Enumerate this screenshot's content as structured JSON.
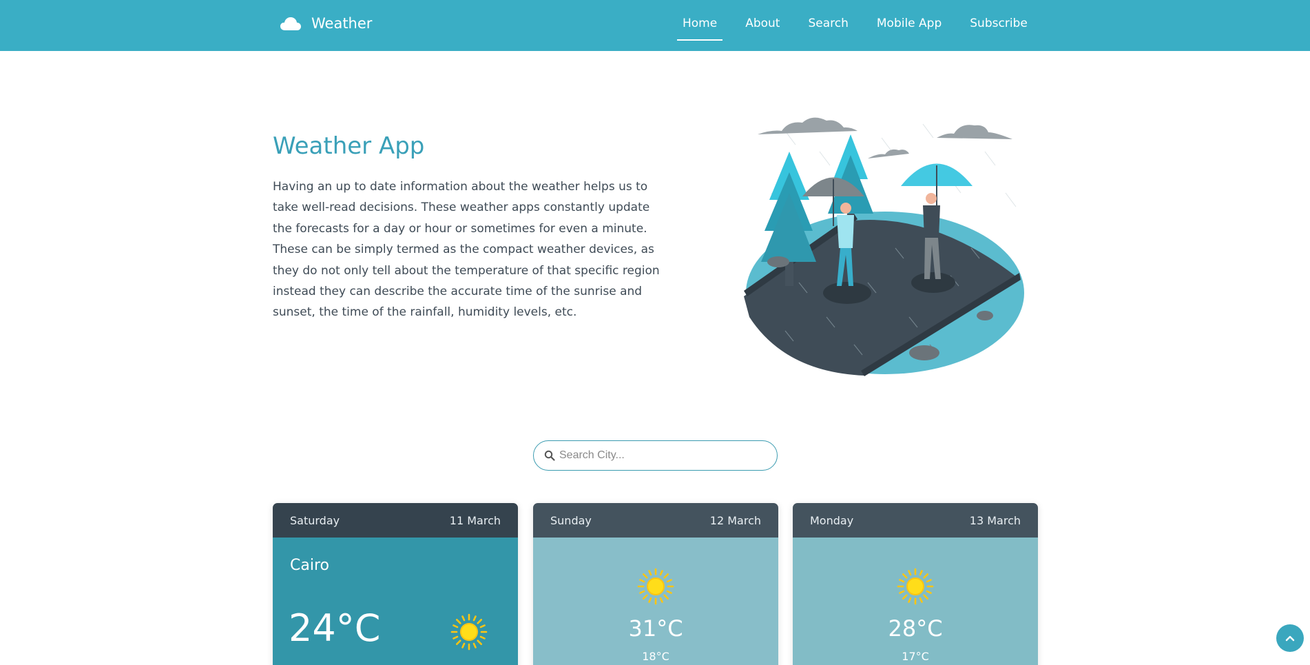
{
  "nav": {
    "brand": "Weather",
    "brand_icon": "cloud-icon",
    "links": [
      {
        "label": "Home",
        "active": true
      },
      {
        "label": "About"
      },
      {
        "label": "Search"
      },
      {
        "label": "Mobile App"
      },
      {
        "label": "Subscribe"
      }
    ]
  },
  "hero": {
    "title": "Weather App",
    "description": "Having an up to date information about the weather helps us to take well-read decisions. These weather apps constantly update the forecasts for a day or hour or sometimes for even a minute. These can be simply termed as the compact weather devices, as they do not only tell about the temperature of that specific region instead they can describe the accurate time of the sunrise and sunset, the time of the rainfall, humidity levels, etc."
  },
  "search": {
    "placeholder": "Search City...",
    "value": "",
    "icon": "search-icon"
  },
  "forecast": [
    {
      "day": "Saturday",
      "date": "11 March",
      "city": "Cairo",
      "temp": "24°C",
      "icon": "sun-icon"
    },
    {
      "day": "Sunday",
      "date": "12 March",
      "max": "31°C",
      "min": "18°C",
      "icon": "sun-icon"
    },
    {
      "day": "Monday",
      "date": "13 March",
      "max": "28°C",
      "min": "17°C",
      "icon": "sun-icon"
    }
  ],
  "scroll_top": {
    "icon": "chevron-up-icon"
  },
  "colors": {
    "navbar": "#3aaec5",
    "accent": "#3aa0b8",
    "card_today_head": "#35434e",
    "card_today_body": "#3396a9",
    "card_head": "#44535e",
    "card_body": "#88bec9",
    "sun": "#ffd21f"
  }
}
